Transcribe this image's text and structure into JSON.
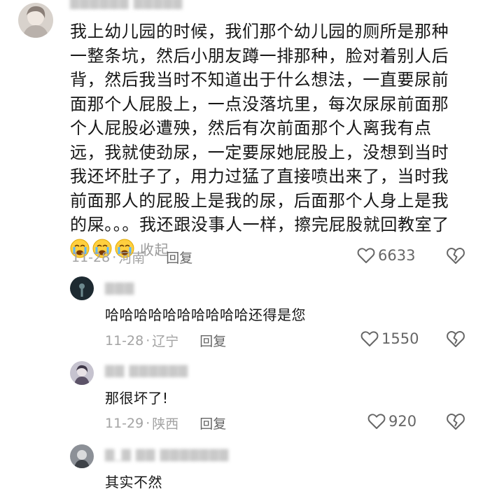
{
  "comments": [
    {
      "text": "我上幼儿园的时候，我们那个幼儿园的厕所是那种一整条坑，然后小朋友蹲一排那种，脸对着别人后背，然后我当时不知道出于什么想法，一直要尿前面那个人屁股上，一点没落坑里，每次尿尿前面那个人屁股必遭殃，然后有次前面那个人离我有点远，我就使劲尿，一定要尿她屁股上，没想到当时我还坏肚子了，用力过猛了直接喷出来了，当时我前面那人的屁股上是我的尿，后面那个人身上是我的屎。。。我还跟没事人一样，擦完屁股就回教室了",
      "collapse_label": "收起",
      "date": "11-28",
      "region": "河南",
      "reply_label": "回复",
      "likes": "6633"
    },
    {
      "text": "哈哈哈哈哈哈哈哈哈哈还得是您",
      "date": "11-28",
      "region": "辽宁",
      "reply_label": "回复",
      "likes": "1550"
    },
    {
      "text": "那很坏了!",
      "date": "11-29",
      "region": "陕西",
      "reply_label": "回复",
      "likes": "920"
    },
    {
      "text": "其实不然"
    }
  ],
  "colors": {
    "text": "#161616",
    "meta": "#a3a3a3",
    "action": "#666666"
  },
  "icons": {
    "like": "heart-outline-icon",
    "dislike": "broken-heart-icon",
    "emoji": "crying-face-emoji"
  }
}
